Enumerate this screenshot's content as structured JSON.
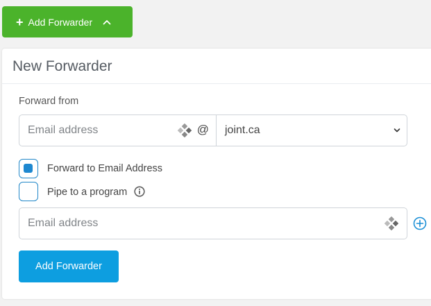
{
  "header_button": {
    "label": "Add Forwarder",
    "plus_icon": "plus",
    "chevron_icon": "chevron-up-icon"
  },
  "form": {
    "title": "New Forwarder",
    "forward_from_label": "Forward from",
    "email_placeholder": "Email address",
    "at_symbol": "@",
    "domain_selected": "joint.ca",
    "options": [
      {
        "label": "Forward to Email Address",
        "checked": true
      },
      {
        "label": "Pipe to a program",
        "checked": false
      }
    ],
    "destination_placeholder": "Email address",
    "submit_label": "Add Forwarder"
  },
  "colors": {
    "header_button": "#4bb32b",
    "submit_button": "#0d9ee0",
    "checkbox_accent": "#1e88d0"
  }
}
